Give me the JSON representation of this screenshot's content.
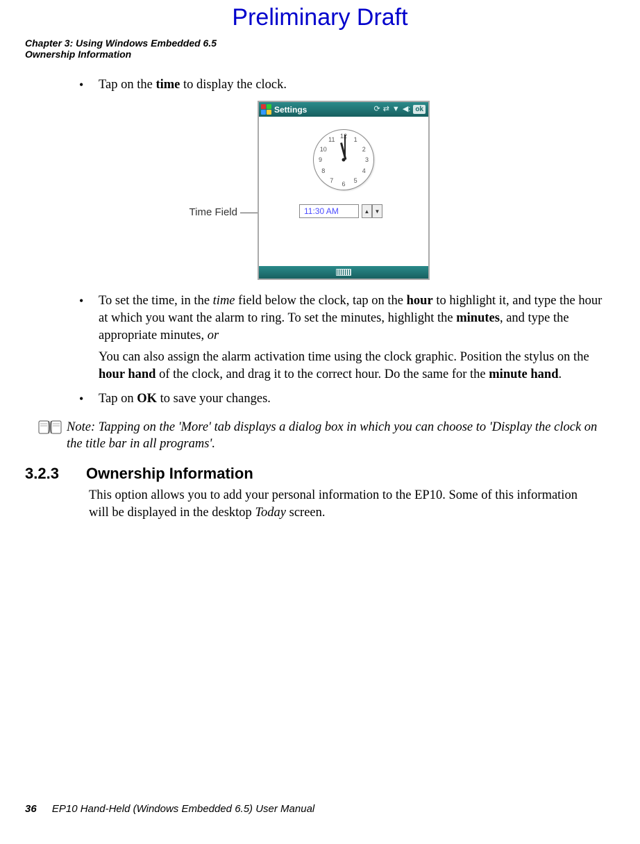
{
  "draft": "Preliminary Draft",
  "header": {
    "chapter": "Chapter 3: Using Windows Embedded 6.5",
    "section": "Ownership Information"
  },
  "bullets": {
    "b1_pre": "Tap on the ",
    "b1_bold": "time",
    "b1_post": " to display the clock.",
    "b2_p1": "To set the time, in the ",
    "b2_i1": "time",
    "b2_p2": " field below the clock, tap on the ",
    "b2_b1": "hour",
    "b2_p3": " to highlight it, and type the hour at which you want the alarm to ring. To set the minutes, highlight the ",
    "b2_b2": "minutes",
    "b2_p4": ", and type the appropriate minutes, ",
    "b2_i2": "or",
    "b2f_p1": "You can also assign the alarm activation time using the clock graphic. Position the stylus on the ",
    "b2f_b1": "hour hand",
    "b2f_p2": " of the clock, and drag it to the correct hour. Do the same for the ",
    "b2f_b2": "minute hand",
    "b2f_p3": ".",
    "b3_p1": "Tap on ",
    "b3_b1": "OK",
    "b3_p2": " to save your changes."
  },
  "figure": {
    "callout_label": "Time Field",
    "title": "Settings",
    "time_value": "11:30 AM",
    "ok_label": "ok",
    "clock": {
      "n1": "1",
      "n2": "2",
      "n3": "3",
      "n4": "4",
      "n5": "5",
      "n6": "6",
      "n7": "7",
      "n8": "8",
      "n9": "9",
      "n10": "10",
      "n11": "11",
      "n12": "12"
    }
  },
  "note": {
    "prefix": "Note: ",
    "text": "Tapping on the 'More' tab displays a dialog box in which you can choose to 'Display the clock on the title bar in all programs'."
  },
  "section323": {
    "num": "3.2.3",
    "title": "Ownership Information",
    "body_p1": "This option allows you to add your personal information to the EP10. Some of this information will be displayed in the desktop ",
    "body_i1": "Today",
    "body_p2": " screen."
  },
  "footer": {
    "page_number": "36",
    "manual": "EP10 Hand-Held (Windows Embedded 6.5) User Manual"
  }
}
